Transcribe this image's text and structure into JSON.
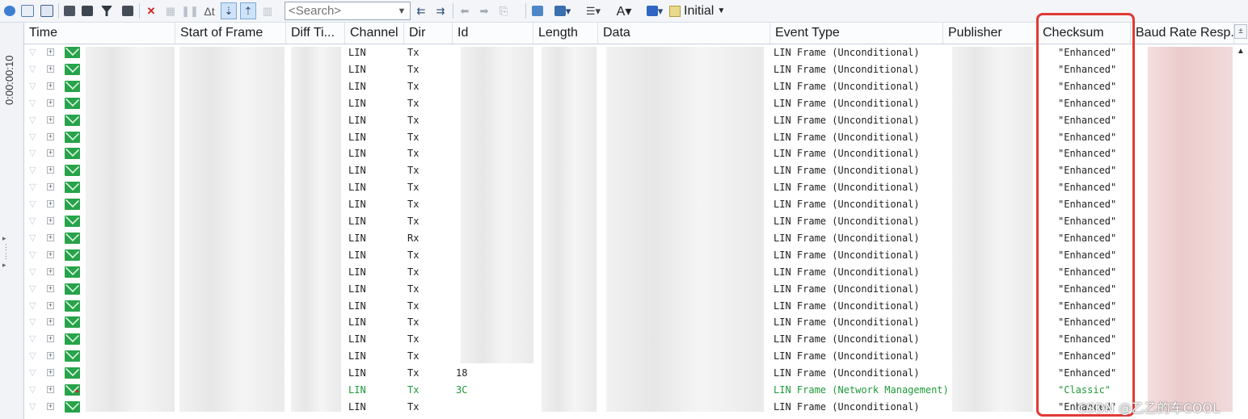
{
  "toolbar": {
    "search_placeholder": "<Search>",
    "initial_label": "Initial",
    "icons": [
      "info-icon",
      "chart-icon",
      "export-icon",
      "filter-icon",
      "binoculars-filter-icon",
      "funnel-icon",
      "binoculars-icon",
      "clear-icon",
      "disabled-icon",
      "pause-icon",
      "delta-time-icon",
      "scroll-down-icon",
      "scroll-toggle-icon",
      "columns-icon",
      "find-prev-icon",
      "find-next-icon",
      "arrow-left-icon",
      "arrow-right-icon",
      "paste-icon",
      "layout-icon",
      "layout-dropdown-icon",
      "filter-line-icon",
      "font-icon",
      "color-icon",
      "initial-icon"
    ]
  },
  "timestrip": {
    "label": "0:00:00:10"
  },
  "columns": [
    "Time",
    "Start of Frame",
    "Diff Ti...",
    "Channel",
    "Dir",
    "Id",
    "Length",
    "Data",
    "Event Type",
    "Publisher",
    "Checksum",
    "Baud Rate Resp..."
  ],
  "rows": [
    {
      "channel": "LIN",
      "dir": "Tx",
      "id": "",
      "event": "LIN Frame (Unconditional)",
      "checksum": "\"Enhanced\"",
      "color": "normal"
    },
    {
      "channel": "LIN",
      "dir": "Tx",
      "id": "",
      "event": "LIN Frame (Unconditional)",
      "checksum": "\"Enhanced\"",
      "color": "normal"
    },
    {
      "channel": "LIN",
      "dir": "Tx",
      "id": "",
      "event": "LIN Frame (Unconditional)",
      "checksum": "\"Enhanced\"",
      "color": "normal"
    },
    {
      "channel": "LIN",
      "dir": "Tx",
      "id": "",
      "event": "LIN Frame (Unconditional)",
      "checksum": "\"Enhanced\"",
      "color": "normal"
    },
    {
      "channel": "LIN",
      "dir": "Tx",
      "id": "",
      "event": "LIN Frame (Unconditional)",
      "checksum": "\"Enhanced\"",
      "color": "normal"
    },
    {
      "channel": "LIN",
      "dir": "Tx",
      "id": "",
      "event": "LIN Frame (Unconditional)",
      "checksum": "\"Enhanced\"",
      "color": "normal"
    },
    {
      "channel": "LIN",
      "dir": "Tx",
      "id": "",
      "event": "LIN Frame (Unconditional)",
      "checksum": "\"Enhanced\"",
      "color": "normal"
    },
    {
      "channel": "LIN",
      "dir": "Tx",
      "id": "",
      "event": "LIN Frame (Unconditional)",
      "checksum": "\"Enhanced\"",
      "color": "normal"
    },
    {
      "channel": "LIN",
      "dir": "Tx",
      "id": "",
      "event": "LIN Frame (Unconditional)",
      "checksum": "\"Enhanced\"",
      "color": "normal"
    },
    {
      "channel": "LIN",
      "dir": "Tx",
      "id": "",
      "event": "LIN Frame (Unconditional)",
      "checksum": "\"Enhanced\"",
      "color": "normal"
    },
    {
      "channel": "LIN",
      "dir": "Tx",
      "id": "",
      "event": "LIN Frame (Unconditional)",
      "checksum": "\"Enhanced\"",
      "color": "normal"
    },
    {
      "channel": "LIN",
      "dir": "Rx",
      "id": "",
      "event": "LIN Frame (Unconditional)",
      "checksum": "\"Enhanced\"",
      "color": "normal"
    },
    {
      "channel": "LIN",
      "dir": "Tx",
      "id": "",
      "event": "LIN Frame (Unconditional)",
      "checksum": "\"Enhanced\"",
      "color": "normal"
    },
    {
      "channel": "LIN",
      "dir": "Tx",
      "id": "",
      "event": "LIN Frame (Unconditional)",
      "checksum": "\"Enhanced\"",
      "color": "normal"
    },
    {
      "channel": "LIN",
      "dir": "Tx",
      "id": "",
      "event": "LIN Frame (Unconditional)",
      "checksum": "\"Enhanced\"",
      "color": "normal"
    },
    {
      "channel": "LIN",
      "dir": "Tx",
      "id": "",
      "event": "LIN Frame (Unconditional)",
      "checksum": "\"Enhanced\"",
      "color": "normal"
    },
    {
      "channel": "LIN",
      "dir": "Tx",
      "id": "",
      "event": "LIN Frame (Unconditional)",
      "checksum": "\"Enhanced\"",
      "color": "normal"
    },
    {
      "channel": "LIN",
      "dir": "Tx",
      "id": "",
      "event": "LIN Frame (Unconditional)",
      "checksum": "\"Enhanced\"",
      "color": "normal"
    },
    {
      "channel": "LIN",
      "dir": "Tx",
      "id": "",
      "event": "LIN Frame (Unconditional)",
      "checksum": "\"Enhanced\"",
      "color": "normal"
    },
    {
      "channel": "LIN",
      "dir": "Tx",
      "id": "18",
      "event": "LIN Frame (Unconditional)",
      "checksum": "\"Enhanced\"",
      "color": "normal"
    },
    {
      "channel": "LIN",
      "dir": "Tx",
      "id": "3C",
      "event": "LIN Frame (Network Management)",
      "checksum": "\"Classic\"",
      "color": "green"
    },
    {
      "channel": "LIN",
      "dir": "Tx",
      "id": "",
      "event": "LIN Frame (Unconditional)",
      "checksum": "\"Enhanced\"",
      "color": "normal"
    }
  ],
  "watermark": "CSDN @乙乙的车COOL",
  "colors": {
    "accent_highlight": "#e03a35",
    "network_mgmt_text": "#1f9a3a",
    "envelope": "#27a34a"
  }
}
